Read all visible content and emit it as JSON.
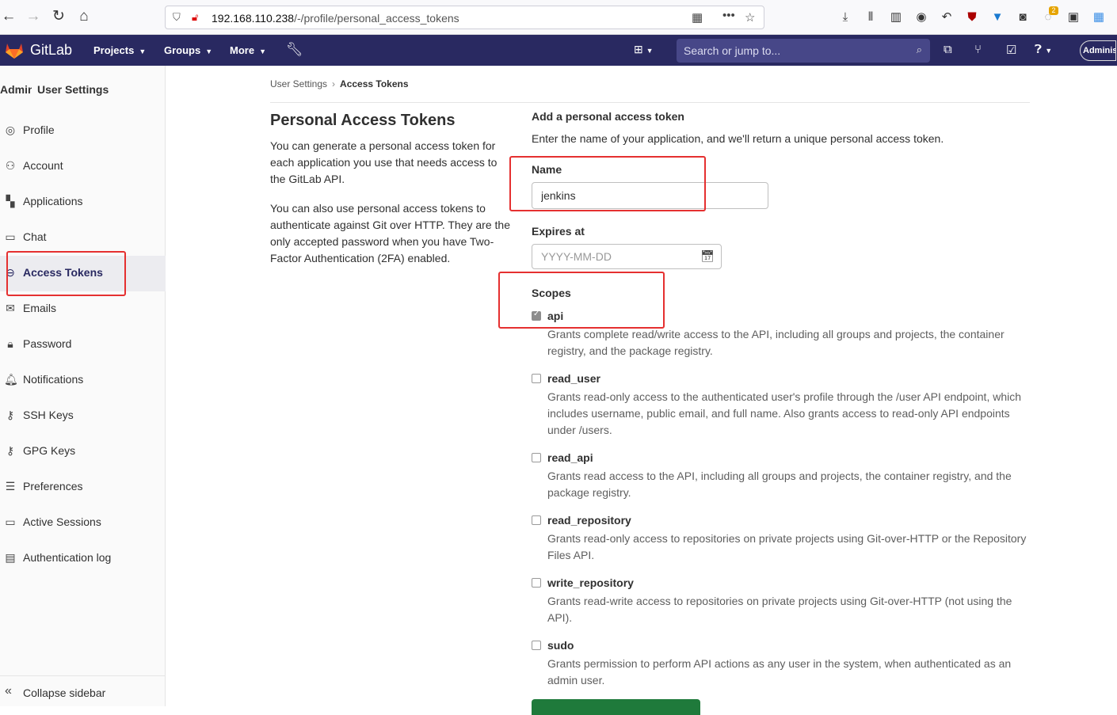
{
  "browser": {
    "url_host": "192.168.110.238",
    "url_path": "/-/profile/personal_access_tokens",
    "badge_count": "2"
  },
  "gitlab_nav": {
    "brand": "GitLab",
    "menus": [
      "Projects",
      "Groups",
      "More"
    ],
    "search_placeholder": "Search or jump to...",
    "avatar_label": "Administrator"
  },
  "sidebar": {
    "header_avatar": "Administrator",
    "header_title": "User Settings",
    "items": [
      {
        "label": "Profile",
        "icon": "profile-icon",
        "active": false
      },
      {
        "label": "Account",
        "icon": "account-icon",
        "active": false
      },
      {
        "label": "Applications",
        "icon": "applications-icon",
        "active": false
      },
      {
        "label": "Chat",
        "icon": "chat-icon",
        "active": false
      },
      {
        "label": "Access Tokens",
        "icon": "token-icon",
        "active": true
      },
      {
        "label": "Emails",
        "icon": "mail-icon",
        "active": false
      },
      {
        "label": "Password",
        "icon": "lock-icon",
        "active": false
      },
      {
        "label": "Notifications",
        "icon": "bell-icon",
        "active": false
      },
      {
        "label": "SSH Keys",
        "icon": "key-icon",
        "active": false
      },
      {
        "label": "GPG Keys",
        "icon": "key-icon",
        "active": false
      },
      {
        "label": "Preferences",
        "icon": "preferences-icon",
        "active": false
      },
      {
        "label": "Active Sessions",
        "icon": "monitor-icon",
        "active": false
      },
      {
        "label": "Authentication log",
        "icon": "log-icon",
        "active": false
      }
    ],
    "collapse_label": "Collapse sidebar"
  },
  "breadcrumb": {
    "parent": "User Settings",
    "current": "Access Tokens"
  },
  "left_col": {
    "title": "Personal Access Tokens",
    "para1": "You can generate a personal access token for each application you use that needs access to the GitLab API.",
    "para2": "You can also use personal access tokens to authenticate against Git over HTTP. They are the only accepted password when you have Two-Factor Authentication (2FA) enabled."
  },
  "form": {
    "heading": "Add a personal access token",
    "intro": "Enter the name of your application, and we'll return a unique personal access token.",
    "name_label": "Name",
    "name_value": "jenkins",
    "expires_label": "Expires at",
    "expires_placeholder": "YYYY-MM-DD",
    "scopes_label": "Scopes",
    "scopes": [
      {
        "name": "api",
        "checked": true,
        "desc": "Grants complete read/write access to the API, including all groups and projects, the container registry, and the package registry."
      },
      {
        "name": "read_user",
        "checked": false,
        "desc": "Grants read-only access to the authenticated user's profile through the /user API endpoint, which includes username, public email, and full name. Also grants access to read-only API endpoints under /users."
      },
      {
        "name": "read_api",
        "checked": false,
        "desc": "Grants read access to the API, including all groups and projects, the container registry, and the package registry."
      },
      {
        "name": "read_repository",
        "checked": false,
        "desc": "Grants read-only access to repositories on private projects using Git-over-HTTP or the Repository Files API."
      },
      {
        "name": "write_repository",
        "checked": false,
        "desc": "Grants read-write access to repositories on private projects using Git-over-HTTP (not using the API)."
      },
      {
        "name": "sudo",
        "checked": false,
        "desc": "Grants permission to perform API actions as any user in the system, when authenticated as an admin user."
      }
    ]
  },
  "colors": {
    "nav_bg": "#292961",
    "highlight": "#e53030",
    "submit": "#1f7a3b"
  }
}
